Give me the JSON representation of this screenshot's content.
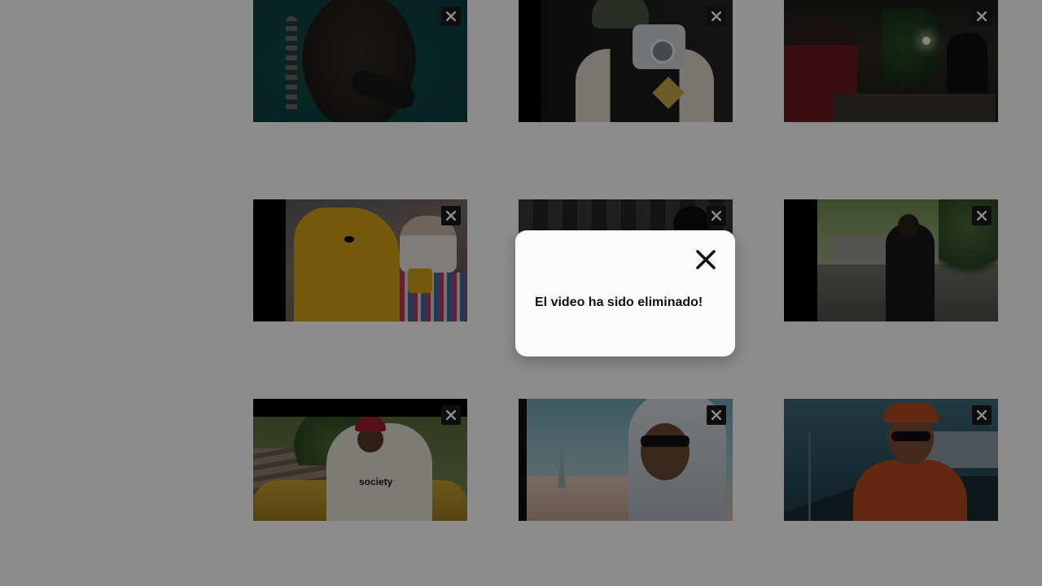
{
  "videos": [
    {
      "scene": "performer-with-microphone"
    },
    {
      "scene": "person-with-instant-camera"
    },
    {
      "scene": "dj-indoors-with-plants"
    },
    {
      "scene": "cartoon-dog-record-shop"
    },
    {
      "scene": "dark-studio-figure"
    },
    {
      "scene": "man-walking-suburban-street"
    },
    {
      "scene": "man-leaning-on-yellow-car",
      "shirt_text": "society"
    },
    {
      "scene": "hooded-man-with-sunglasses"
    },
    {
      "scene": "man-in-orange-cap-by-train"
    }
  ],
  "remove_icon": "close-icon",
  "modal": {
    "message": "El video ha sido eliminado!",
    "close_icon": "close-icon"
  },
  "colors": {
    "overlay": "#000000",
    "modal_background": "#fbfbfb",
    "remove_button": "#1b1b1b"
  }
}
